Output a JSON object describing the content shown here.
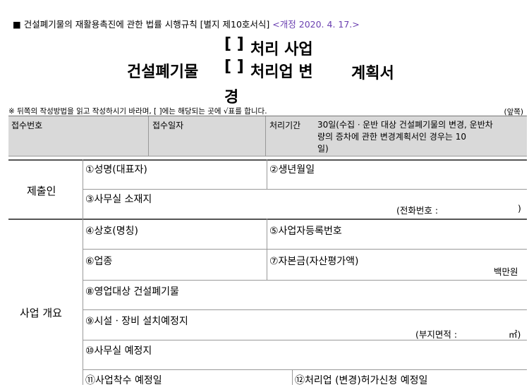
{
  "header": {
    "bullet": "■",
    "law_ref": "건설폐기물의 재활용촉진에 관한 법률 시행규칙 [별지 제10호서식]",
    "revision": "<개정 2020. 4. 17.>"
  },
  "title": {
    "main": "건설폐기물",
    "bracket1": "[  ]",
    "option1": "처리 사업",
    "bracket2": "[  ]",
    "option2": "처리업  변",
    "suffix": "계획서",
    "wrap": "경"
  },
  "instructions": {
    "note": "※ 뒤쪽의 작성방법을 읽고 작성하시기 바라며, [  ]에는 해당되는 곳에 √표를 합니다.",
    "page_side": "(앞쪽)"
  },
  "receipt": {
    "number_label": "접수번호",
    "date_label": "접수일자",
    "period_label": "처리기간",
    "period_text_1": "30일(수집ㆍ운반 대상 건설폐기물의 변경, 운반차",
    "period_text_2": "량의 증차에 관한 변경계획서인 경우는 10",
    "period_text_3": "일)"
  },
  "submitter": {
    "section_label": "제출인",
    "name_label": "①성명(대표자)",
    "birth_label": "②생년월일",
    "office_label": "③사무실 소재지",
    "phone_label": "(전화번호 :",
    "phone_close": ")"
  },
  "business": {
    "section_label": "사업 개요",
    "trade_name_label": "④상호(명칭)",
    "reg_no_label": "⑤사업자등록번호",
    "industry_label": "⑥업종",
    "capital_label": "⑦자본금(자산평가액)",
    "capital_unit": "백만원",
    "waste_label": "⑧영업대상 건설폐기물",
    "facility_label": "⑨시설ㆍ장비 설치예정지",
    "area_label": "(부지면적 :",
    "area_unit": "㎡)",
    "office_plan_label": "⑩사무실 예정지",
    "start_label": "⑪사업착수 예정일",
    "permit_label": "⑫처리업 (변경)허가신청 예정일"
  }
}
